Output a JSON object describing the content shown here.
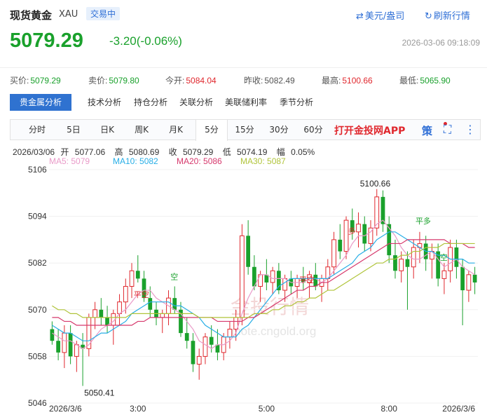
{
  "header": {
    "title": "现货黄金",
    "symbol": "XAU",
    "status_badge": "交易中",
    "currency_toggle": "美元/盎司",
    "refresh": "刷新行情",
    "price": "5079.29",
    "change": "-3.20(-0.06%)",
    "timestamp": "2026-03-06 09:18:09"
  },
  "stats": [
    {
      "label": "买价:",
      "value": "5079.29",
      "tone": "dn"
    },
    {
      "label": "卖价:",
      "value": "5079.80",
      "tone": "dn"
    },
    {
      "label": "今开:",
      "value": "5084.04",
      "tone": "up"
    },
    {
      "label": "昨收:",
      "value": "5082.49",
      "tone": ""
    },
    {
      "label": "最高:",
      "value": "5100.66",
      "tone": "up"
    },
    {
      "label": "最低:",
      "value": "5065.90",
      "tone": "dn"
    }
  ],
  "analysis_tabs": [
    "贵金属分析",
    "技术分析",
    "持仓分析",
    "关联分析",
    "美联储利率",
    "季节分析"
  ],
  "period_tabs": [
    "分时",
    "5日",
    "日K",
    "周K",
    "月K",
    "5分",
    "15分",
    "30分",
    "60分"
  ],
  "active_period": "5分",
  "promo": "打开金投网APP",
  "tools": {
    "strategy": "策",
    "fullscreen": "⛶",
    "more": "⋮"
  },
  "ohlc": {
    "date": "2026/03/06",
    "open_label": "开",
    "open": "5077.06",
    "high_label": "高",
    "high": "5080.69",
    "close_label": "收",
    "close": "5079.29",
    "low_label": "低",
    "low": "5074.19",
    "amp_label": "幅",
    "amp": "0.05%"
  },
  "ma_legend": [
    {
      "label": "MA5: 5079",
      "color": "#e99ac8"
    },
    {
      "label": "MA10: 5082",
      "color": "#27aee6"
    },
    {
      "label": "MA20: 5086",
      "color": "#d6386c"
    },
    {
      "label": "MA30: 5087",
      "color": "#b0c43a"
    }
  ],
  "watermark": {
    "text": "金投行情",
    "url": "quote.cngold.org"
  },
  "chart_data": {
    "type": "candlestick",
    "y_ticks": [
      "5106",
      "5094",
      "5082",
      "5070",
      "5058",
      "5046"
    ],
    "ylim": [
      5046,
      5106
    ],
    "x_ticks": [
      "2026/3/6",
      "3:00",
      "5:00",
      "8:00",
      "2026/3/6"
    ],
    "up_color": "#e0282e",
    "down_color": "#1aa12c",
    "annotations": [
      {
        "text": "5100.66",
        "kind": "high"
      },
      {
        "text": "5050.41",
        "kind": "low"
      },
      {
        "text": "平空",
        "color": "#e0282e"
      },
      {
        "text": "空",
        "color": "#1aa12c"
      },
      {
        "text": "平空",
        "color": "#e0282e"
      },
      {
        "text": "多",
        "color": "#e0282e"
      },
      {
        "text": "平多",
        "color": "#1aa12c"
      },
      {
        "text": "空",
        "color": "#1aa12c"
      }
    ],
    "candles": [
      {
        "o": 5065,
        "h": 5067,
        "l": 5061,
        "c": 5062
      },
      {
        "o": 5062,
        "h": 5065,
        "l": 5057,
        "c": 5059
      },
      {
        "o": 5059,
        "h": 5066,
        "l": 5055,
        "c": 5064
      },
      {
        "o": 5064,
        "h": 5066,
        "l": 5056,
        "c": 5058
      },
      {
        "o": 5058,
        "h": 5062,
        "l": 5054,
        "c": 5061
      },
      {
        "o": 5061,
        "h": 5064,
        "l": 5050.41,
        "c": 5060
      },
      {
        "o": 5060,
        "h": 5069,
        "l": 5058,
        "c": 5068
      },
      {
        "o": 5068,
        "h": 5072,
        "l": 5065,
        "c": 5070
      },
      {
        "o": 5070,
        "h": 5073,
        "l": 5066,
        "c": 5068
      },
      {
        "o": 5068,
        "h": 5071,
        "l": 5064,
        "c": 5066
      },
      {
        "o": 5066,
        "h": 5070,
        "l": 5061,
        "c": 5069
      },
      {
        "o": 5069,
        "h": 5074,
        "l": 5066,
        "c": 5072
      },
      {
        "o": 5072,
        "h": 5078,
        "l": 5069,
        "c": 5076
      },
      {
        "o": 5076,
        "h": 5082,
        "l": 5073,
        "c": 5080
      },
      {
        "o": 5080,
        "h": 5084,
        "l": 5077,
        "c": 5078
      },
      {
        "o": 5078,
        "h": 5080,
        "l": 5072,
        "c": 5073
      },
      {
        "o": 5073,
        "h": 5076,
        "l": 5068,
        "c": 5070
      },
      {
        "o": 5070,
        "h": 5072,
        "l": 5066,
        "c": 5068
      },
      {
        "o": 5068,
        "h": 5070,
        "l": 5064,
        "c": 5069
      },
      {
        "o": 5069,
        "h": 5075,
        "l": 5066,
        "c": 5073
      },
      {
        "o": 5073,
        "h": 5076,
        "l": 5069,
        "c": 5070
      },
      {
        "o": 5070,
        "h": 5072,
        "l": 5063,
        "c": 5064
      },
      {
        "o": 5064,
        "h": 5068,
        "l": 5060,
        "c": 5062
      },
      {
        "o": 5062,
        "h": 5064,
        "l": 5054,
        "c": 5056
      },
      {
        "o": 5056,
        "h": 5060,
        "l": 5052,
        "c": 5058
      },
      {
        "o": 5058,
        "h": 5064,
        "l": 5056,
        "c": 5063
      },
      {
        "o": 5063,
        "h": 5066,
        "l": 5059,
        "c": 5061
      },
      {
        "o": 5061,
        "h": 5065,
        "l": 5057,
        "c": 5059
      },
      {
        "o": 5059,
        "h": 5064,
        "l": 5057,
        "c": 5063
      },
      {
        "o": 5063,
        "h": 5067,
        "l": 5060,
        "c": 5065
      },
      {
        "o": 5065,
        "h": 5070,
        "l": 5062,
        "c": 5068
      },
      {
        "o": 5068,
        "h": 5092,
        "l": 5066,
        "c": 5089
      },
      {
        "o": 5089,
        "h": 5093,
        "l": 5079,
        "c": 5081
      },
      {
        "o": 5081,
        "h": 5084,
        "l": 5075,
        "c": 5076
      },
      {
        "o": 5076,
        "h": 5080,
        "l": 5072,
        "c": 5079
      },
      {
        "o": 5079,
        "h": 5083,
        "l": 5075,
        "c": 5077
      },
      {
        "o": 5077,
        "h": 5081,
        "l": 5074,
        "c": 5080
      },
      {
        "o": 5080,
        "h": 5082,
        "l": 5074,
        "c": 5075
      },
      {
        "o": 5075,
        "h": 5079,
        "l": 5072,
        "c": 5078
      },
      {
        "o": 5078,
        "h": 5080,
        "l": 5074,
        "c": 5076
      },
      {
        "o": 5076,
        "h": 5079,
        "l": 5073,
        "c": 5078
      },
      {
        "o": 5078,
        "h": 5081,
        "l": 5075,
        "c": 5077
      },
      {
        "o": 5077,
        "h": 5080,
        "l": 5073,
        "c": 5079
      },
      {
        "o": 5079,
        "h": 5082,
        "l": 5075,
        "c": 5076
      },
      {
        "o": 5076,
        "h": 5079,
        "l": 5072,
        "c": 5078
      },
      {
        "o": 5078,
        "h": 5083,
        "l": 5075,
        "c": 5081
      },
      {
        "o": 5081,
        "h": 5090,
        "l": 5079,
        "c": 5088
      },
      {
        "o": 5088,
        "h": 5092,
        "l": 5083,
        "c": 5085
      },
      {
        "o": 5085,
        "h": 5094,
        "l": 5083,
        "c": 5093
      },
      {
        "o": 5093,
        "h": 5096,
        "l": 5088,
        "c": 5090
      },
      {
        "o": 5090,
        "h": 5095,
        "l": 5086,
        "c": 5092
      },
      {
        "o": 5092,
        "h": 5094,
        "l": 5085,
        "c": 5087
      },
      {
        "o": 5087,
        "h": 5093,
        "l": 5085,
        "c": 5091
      },
      {
        "o": 5091,
        "h": 5101,
        "l": 5089,
        "c": 5099
      },
      {
        "o": 5099,
        "h": 5100.66,
        "l": 5090,
        "c": 5092
      },
      {
        "o": 5092,
        "h": 5094,
        "l": 5082,
        "c": 5084
      },
      {
        "o": 5084,
        "h": 5088,
        "l": 5078,
        "c": 5080
      },
      {
        "o": 5080,
        "h": 5085,
        "l": 5077,
        "c": 5083
      },
      {
        "o": 5083,
        "h": 5085,
        "l": 5070,
        "c": 5081
      },
      {
        "o": 5081,
        "h": 5088,
        "l": 5078,
        "c": 5086
      },
      {
        "o": 5086,
        "h": 5090,
        "l": 5082,
        "c": 5087
      },
      {
        "o": 5087,
        "h": 5089,
        "l": 5080,
        "c": 5083
      },
      {
        "o": 5083,
        "h": 5087,
        "l": 5078,
        "c": 5085
      },
      {
        "o": 5085,
        "h": 5087,
        "l": 5076,
        "c": 5078
      },
      {
        "o": 5078,
        "h": 5082,
        "l": 5074,
        "c": 5080
      },
      {
        "o": 5080,
        "h": 5088,
        "l": 5077,
        "c": 5086
      },
      {
        "o": 5086,
        "h": 5088,
        "l": 5078,
        "c": 5081
      },
      {
        "o": 5081,
        "h": 5083,
        "l": 5066,
        "c": 5075
      },
      {
        "o": 5075,
        "h": 5080,
        "l": 5072,
        "c": 5079
      },
      {
        "o": 5079,
        "h": 5081,
        "l": 5074,
        "c": 5077
      }
    ],
    "ma": [
      {
        "name": "MA5",
        "color": "#e99ac8",
        "values": [
          5064,
          5063,
          5062,
          5062,
          5061,
          5060,
          5061,
          5063,
          5065,
          5066,
          5067,
          5069,
          5070,
          5072,
          5074,
          5075,
          5075,
          5073,
          5072,
          5071,
          5070,
          5069,
          5067,
          5065,
          5062,
          5061,
          5060,
          5061,
          5061,
          5062,
          5064,
          5069,
          5073,
          5076,
          5079,
          5079,
          5078,
          5078,
          5078,
          5077,
          5077,
          5077,
          5078,
          5078,
          5077,
          5078,
          5080,
          5082,
          5084,
          5087,
          5089,
          5089,
          5090,
          5092,
          5093,
          5091,
          5089,
          5086,
          5084,
          5083,
          5083,
          5084,
          5085,
          5083,
          5081,
          5082,
          5083,
          5081,
          5080,
          5079
        ]
      },
      {
        "name": "MA10",
        "color": "#27aee6",
        "values": [
          5066,
          5065,
          5064,
          5064,
          5063,
          5062,
          5062,
          5063,
          5064,
          5064,
          5065,
          5066,
          5067,
          5069,
          5070,
          5071,
          5072,
          5072,
          5072,
          5072,
          5071,
          5071,
          5070,
          5069,
          5068,
          5066,
          5065,
          5064,
          5063,
          5063,
          5063,
          5065,
          5066,
          5068,
          5070,
          5072,
          5074,
          5076,
          5077,
          5078,
          5078,
          5078,
          5078,
          5078,
          5078,
          5078,
          5079,
          5080,
          5081,
          5082,
          5084,
          5085,
          5086,
          5088,
          5089,
          5090,
          5090,
          5089,
          5088,
          5087,
          5086,
          5085,
          5085,
          5084,
          5084,
          5083,
          5083,
          5083,
          5082,
          5082
        ]
      },
      {
        "name": "MA20",
        "color": "#d6386c",
        "values": [
          5068,
          5068,
          5067,
          5067,
          5066,
          5066,
          5066,
          5066,
          5066,
          5066,
          5066,
          5066,
          5066,
          5066,
          5067,
          5067,
          5068,
          5068,
          5068,
          5068,
          5068,
          5068,
          5068,
          5068,
          5068,
          5068,
          5068,
          5067,
          5067,
          5067,
          5067,
          5067,
          5068,
          5068,
          5069,
          5070,
          5071,
          5072,
          5073,
          5074,
          5075,
          5075,
          5076,
          5076,
          5077,
          5077,
          5078,
          5079,
          5080,
          5081,
          5082,
          5083,
          5084,
          5085,
          5086,
          5087,
          5087,
          5087,
          5088,
          5088,
          5088,
          5088,
          5088,
          5088,
          5088,
          5087,
          5087,
          5087,
          5086,
          5086
        ]
      },
      {
        "name": "MA30",
        "color": "#b0c43a",
        "values": [
          5071,
          5070,
          5070,
          5069,
          5069,
          5068,
          5068,
          5068,
          5068,
          5068,
          5068,
          5068,
          5068,
          5069,
          5069,
          5069,
          5069,
          5069,
          5069,
          5069,
          5069,
          5069,
          5069,
          5069,
          5068,
          5068,
          5068,
          5068,
          5068,
          5068,
          5068,
          5068,
          5068,
          5069,
          5069,
          5069,
          5070,
          5070,
          5071,
          5071,
          5072,
          5072,
          5073,
          5073,
          5074,
          5075,
          5075,
          5076,
          5077,
          5078,
          5079,
          5080,
          5081,
          5082,
          5082,
          5083,
          5083,
          5084,
          5084,
          5085,
          5085,
          5086,
          5086,
          5086,
          5087,
          5087,
          5087,
          5087,
          5087,
          5087
        ]
      }
    ]
  }
}
